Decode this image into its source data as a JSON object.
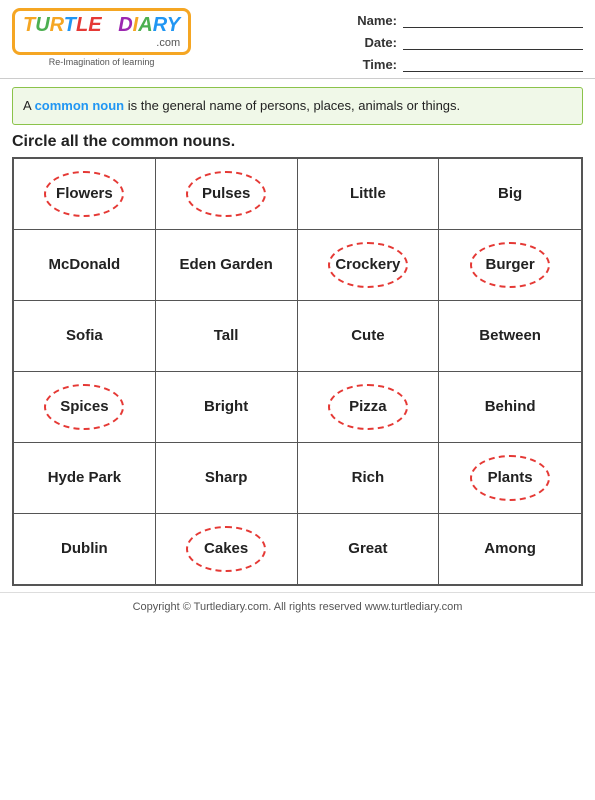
{
  "header": {
    "logo_text": "TURTLE DIARY",
    "logo_com": ".com",
    "tagline": "Re-Imagination of learning",
    "name_label": "Name:",
    "date_label": "Date:",
    "time_label": "Time:"
  },
  "info": {
    "prefix": "A ",
    "highlight": "common noun",
    "suffix": " is the general name of persons, places, animals or things."
  },
  "instruction": "Circle all the common nouns.",
  "grid": {
    "rows": [
      [
        {
          "text": "Flowers",
          "circled": true
        },
        {
          "text": "Pulses",
          "circled": true
        },
        {
          "text": "Little",
          "circled": false
        },
        {
          "text": "Big",
          "circled": false
        }
      ],
      [
        {
          "text": "McDonald",
          "circled": false
        },
        {
          "text": "Eden Garden",
          "circled": false
        },
        {
          "text": "Crockery",
          "circled": true
        },
        {
          "text": "Burger",
          "circled": true
        }
      ],
      [
        {
          "text": "Sofia",
          "circled": false
        },
        {
          "text": "Tall",
          "circled": false
        },
        {
          "text": "Cute",
          "circled": false
        },
        {
          "text": "Between",
          "circled": false
        }
      ],
      [
        {
          "text": "Spices",
          "circled": true
        },
        {
          "text": "Bright",
          "circled": false
        },
        {
          "text": "Pizza",
          "circled": true
        },
        {
          "text": "Behind",
          "circled": false
        }
      ],
      [
        {
          "text": "Hyde Park",
          "circled": false
        },
        {
          "text": "Sharp",
          "circled": false
        },
        {
          "text": "Rich",
          "circled": false
        },
        {
          "text": "Plants",
          "circled": true
        }
      ],
      [
        {
          "text": "Dublin",
          "circled": false
        },
        {
          "text": "Cakes",
          "circled": true
        },
        {
          "text": "Great",
          "circled": false
        },
        {
          "text": "Among",
          "circled": false
        }
      ]
    ]
  },
  "footer": "Copyright © Turtlediary.com. All rights reserved  www.turtlediary.com"
}
